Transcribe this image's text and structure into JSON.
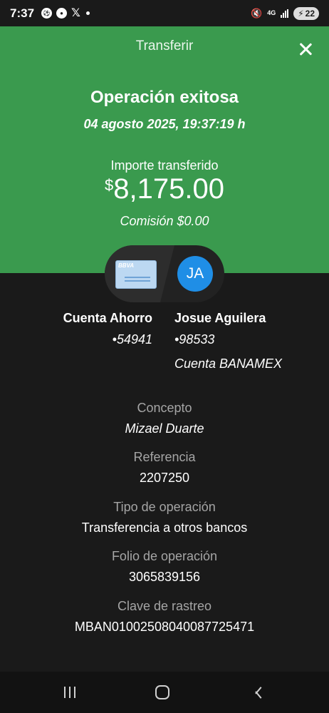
{
  "status_bar": {
    "time": "7:37",
    "network": "4G",
    "battery": "22",
    "icons": [
      "soccer-ball-icon",
      "sports-app-icon",
      "x-logo-icon",
      "notification-dot-icon",
      "mute-icon",
      "signal-icon",
      "battery-charging-icon"
    ]
  },
  "header": {
    "title": "Transferir",
    "status": "Operación exitosa",
    "datetime": "04 agosto 2025, 19:37:19 h",
    "amount_label": "Importe transferido",
    "currency_symbol": "$",
    "amount": "8,175.00",
    "commission": "Comisión  $0.00"
  },
  "accounts": {
    "origin": {
      "card_brand": "BBVA",
      "name": "Cuenta Ahorro",
      "number": "•54941"
    },
    "destination": {
      "initials": "JA",
      "name": "Josue Aguilera",
      "number": "•98533",
      "bank": "Cuenta BANAMEX"
    }
  },
  "details": [
    {
      "label": "Concepto",
      "value": "Mizael Duarte"
    },
    {
      "label": "Referencia",
      "value": "2207250"
    },
    {
      "label": "Tipo de operación",
      "value": "Transferencia a otros bancos"
    },
    {
      "label": "Folio de operación",
      "value": "3065839156"
    },
    {
      "label": "Clave de rastreo",
      "value": "MBAN01002508040087725471"
    }
  ],
  "colors": {
    "header_green": "#3a9a4e",
    "background": "#1a1a1a",
    "avatar_blue": "#1f8ee6",
    "label_gray": "#a5a5a5"
  }
}
